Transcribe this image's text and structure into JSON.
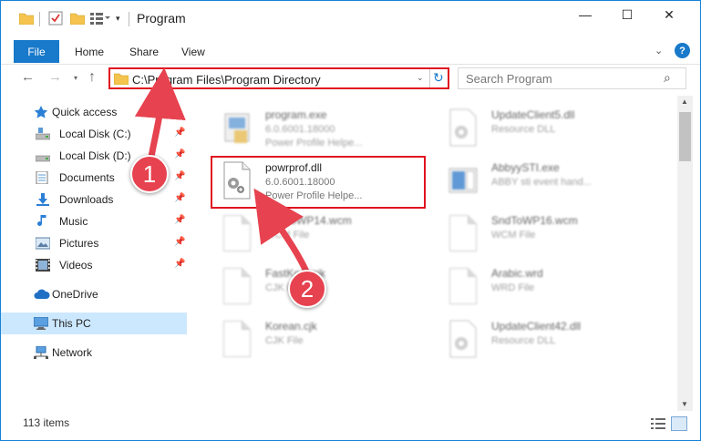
{
  "window": {
    "title": "Program",
    "minimize_glyph": "—",
    "maximize_glyph": "☐",
    "close_glyph": "✕"
  },
  "ribbon": {
    "tabs": [
      {
        "label": "File"
      },
      {
        "label": "Home"
      },
      {
        "label": "Share"
      },
      {
        "label": "View"
      }
    ],
    "help_glyph": "?"
  },
  "nav": {
    "address": "C:\\Program Files\\Program Directory",
    "search_placeholder": "Search Program"
  },
  "sidebar": {
    "items": [
      {
        "label": "Quick access",
        "icon": "star-icon"
      },
      {
        "label": "Local Disk (C:)",
        "icon": "drive-icon",
        "pinned": true
      },
      {
        "label": "Local Disk (D:)",
        "icon": "drive-icon",
        "pinned": true
      },
      {
        "label": "Documents",
        "icon": "documents-icon",
        "pinned": true
      },
      {
        "label": "Downloads",
        "icon": "downloads-icon",
        "pinned": true
      },
      {
        "label": "Music",
        "icon": "music-icon",
        "pinned": true
      },
      {
        "label": "Pictures",
        "icon": "pictures-icon",
        "pinned": true
      },
      {
        "label": "Videos",
        "icon": "videos-icon",
        "pinned": true
      },
      {
        "label": "OneDrive",
        "icon": "onedrive-icon"
      },
      {
        "label": "This PC",
        "icon": "computer-icon",
        "selected": true
      },
      {
        "label": "Network",
        "icon": "network-icon"
      }
    ]
  },
  "files": [
    {
      "name": "program.exe",
      "line1": "6.0.6001.18000",
      "line2": "Power Profile Helpe...",
      "icon": "exe-icon"
    },
    {
      "name": "UpdateClient5.dll",
      "line1": "Resource DLL",
      "line2": "",
      "icon": "dll-icon"
    },
    {
      "name": "powrprof.dll",
      "line1": "6.0.6001.18000",
      "line2": "Power Profile Helpe...",
      "icon": "dll-icon"
    },
    {
      "name": "AbbyySTI.exe",
      "line1": "ABBY sti event hand...",
      "line2": "",
      "icon": "exe-icon"
    },
    {
      "name": "SndToWP14.wcm",
      "line1": "WCM File",
      "line2": "",
      "icon": "file-icon"
    },
    {
      "name": "SndToWP16.wcm",
      "line1": "WCM File",
      "line2": "",
      "icon": "file-icon"
    },
    {
      "name": "FastKo....cjk",
      "line1": "CJK File",
      "line2": "",
      "icon": "file-icon"
    },
    {
      "name": "Arabic.wrd",
      "line1": "WRD File",
      "line2": "",
      "icon": "file-icon"
    },
    {
      "name": "Korean.cjk",
      "line1": "CJK File",
      "line2": "",
      "icon": "file-icon"
    },
    {
      "name": "UpdateClient42.dll",
      "line1": "Resource DLL",
      "line2": "",
      "icon": "dll-icon"
    }
  ],
  "status": {
    "item_count": "113 items"
  },
  "annotations": {
    "callout_1": "1",
    "callout_2": "2",
    "color": "#e7424f"
  },
  "colors": {
    "accent": "#1979ca",
    "highlight_border": "#e0131f",
    "selected_bg": "#cce8ff"
  }
}
